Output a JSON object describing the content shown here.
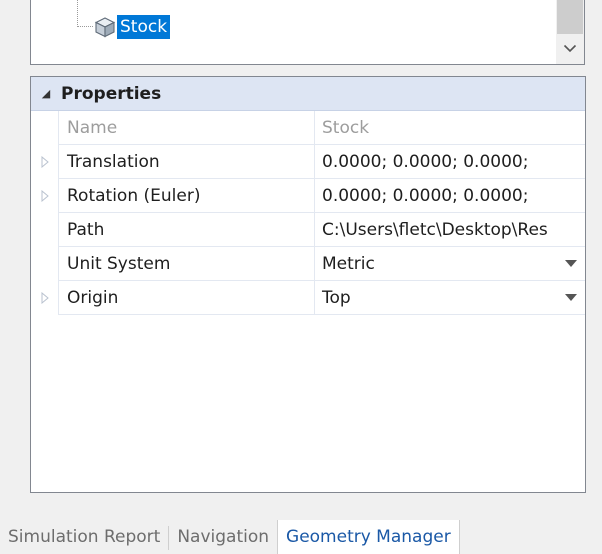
{
  "tree": {
    "selected_node": {
      "label": "Stock",
      "icon": "stock-cube-icon"
    }
  },
  "properties": {
    "title": "Properties",
    "rows": [
      {
        "name": "Name",
        "value": "Stock",
        "expandable": false,
        "dropdown": false,
        "readonly": true
      },
      {
        "name": "Translation",
        "value": "0.0000; 0.0000; 0.0000;",
        "expandable": true,
        "dropdown": false,
        "readonly": false
      },
      {
        "name": "Rotation (Euler)",
        "value": "0.0000; 0.0000; 0.0000;",
        "expandable": true,
        "dropdown": false,
        "readonly": false
      },
      {
        "name": "Path",
        "value": "C:\\Users\\fletc\\Desktop\\Res",
        "expandable": false,
        "dropdown": false,
        "readonly": false
      },
      {
        "name": "Unit System",
        "value": "Metric",
        "expandable": false,
        "dropdown": true,
        "readonly": false
      },
      {
        "name": "Origin",
        "value": "Top",
        "expandable": true,
        "dropdown": true,
        "readonly": false
      }
    ]
  },
  "tabs": [
    {
      "label": "Simulation Report",
      "active": false
    },
    {
      "label": "Navigation",
      "active": false
    },
    {
      "label": "Geometry Manager",
      "active": true
    }
  ],
  "colors": {
    "selection": "#0078d7",
    "header_bg": "#dde5f3",
    "active_tab_text": "#1a58a6"
  }
}
